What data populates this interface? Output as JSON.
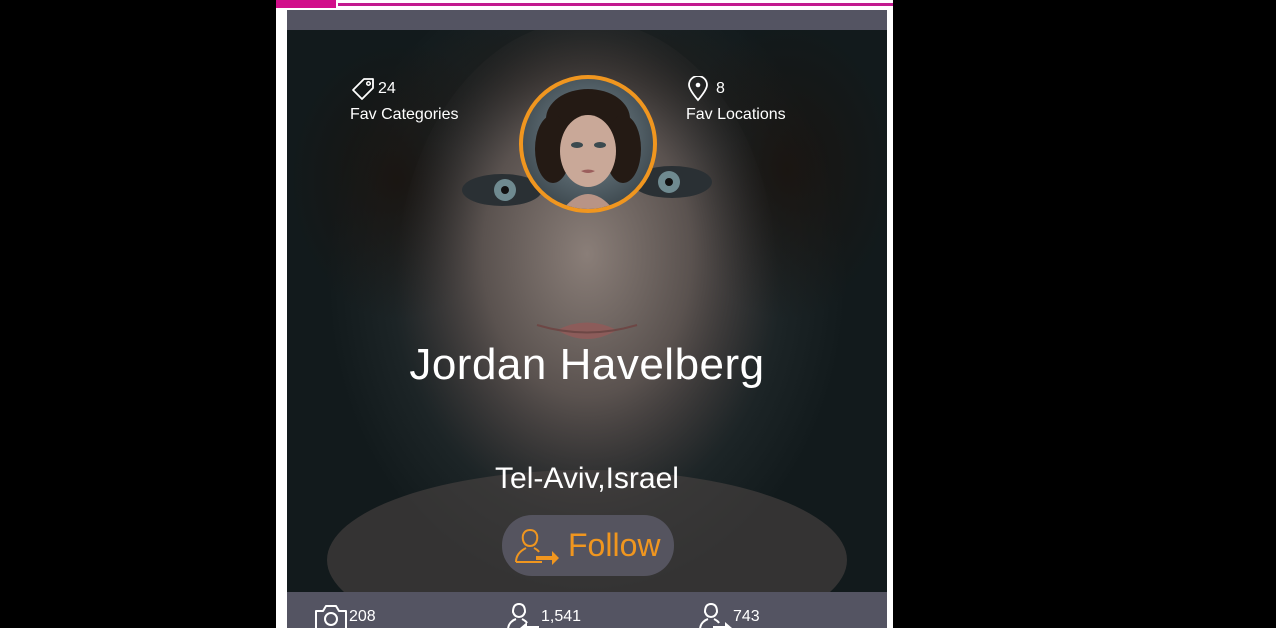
{
  "profile": {
    "name": "Jordan Havelberg",
    "location": "Tel-Aviv,Israel"
  },
  "top_stats": {
    "categories": {
      "count": "24",
      "label": "Fav Categories",
      "icon": "tag-icon"
    },
    "locations": {
      "count": "8",
      "label": "Fav Locations",
      "icon": "map-pin-icon"
    }
  },
  "follow_button": {
    "label": "Follow",
    "icon": "follow-user-icon"
  },
  "bottom_stats": {
    "photos": {
      "count": "208",
      "icon": "camera-icon"
    },
    "followers": {
      "count": "1,541",
      "icon": "followers-icon"
    },
    "following": {
      "count": "743",
      "icon": "following-icon"
    }
  },
  "colors": {
    "accent": "#f0961f",
    "card_bg": "#545462",
    "topbar_accent": "#d10f8a"
  }
}
